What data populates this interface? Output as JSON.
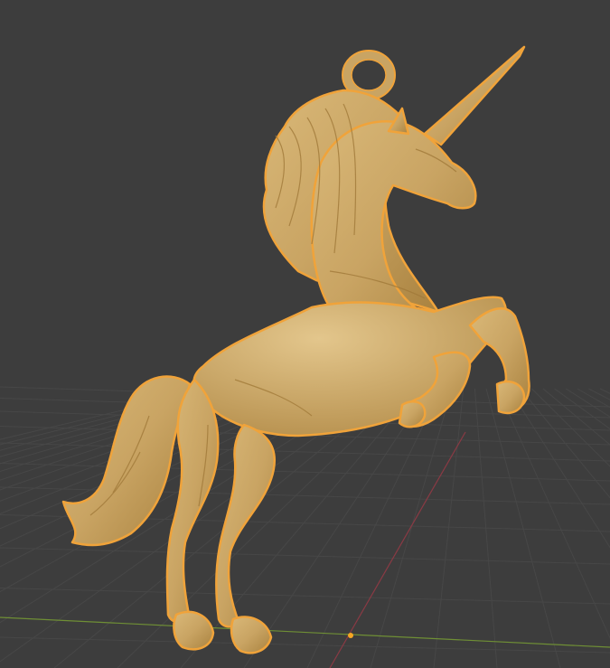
{
  "viewport": {
    "background": "#3d3d3d",
    "grid_color": "#474747",
    "x_axis_color": "#7a9a3a",
    "y_axis_color": "#8a3a44",
    "origin_color": "#f5a623"
  },
  "object": {
    "name": "unicorn-pendant",
    "material_color": "#c9a463",
    "material_shade": "#a9823f",
    "selection_outline_color": "#f0a33a",
    "selected": true
  }
}
